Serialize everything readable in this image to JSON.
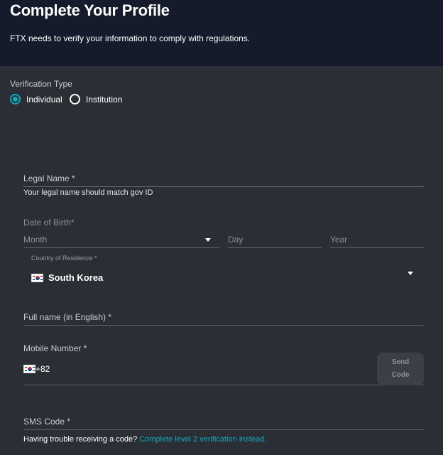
{
  "header": {
    "title": "Complete Your Profile",
    "subtitle": "FTX needs to verify your information to comply with regulations."
  },
  "verification": {
    "label": "Verification Type",
    "options": [
      {
        "label": "Individual",
        "selected": true
      },
      {
        "label": "Institution",
        "selected": false
      }
    ],
    "accent_color": "#11a9bc"
  },
  "legal_name": {
    "label": "Legal Name *",
    "helper": "Your legal name should match gov ID"
  },
  "dob": {
    "label": "Date of Birth*",
    "month_placeholder": "Month",
    "day_placeholder": "Day",
    "year_placeholder": "Year"
  },
  "country": {
    "label": "Country of Residence *",
    "value": "South Korea",
    "flag_icon": "south-korea-flag-icon"
  },
  "full_name": {
    "label": "Full name (in English) *"
  },
  "mobile": {
    "label": "Mobile Number *",
    "dial_code": "+82",
    "send_code_line1": "Send",
    "send_code_line2": "Code"
  },
  "sms": {
    "label": "SMS Code *",
    "trouble_text": "Having trouble receiving a code?",
    "trouble_link": "Complete level 2 verification instead."
  }
}
